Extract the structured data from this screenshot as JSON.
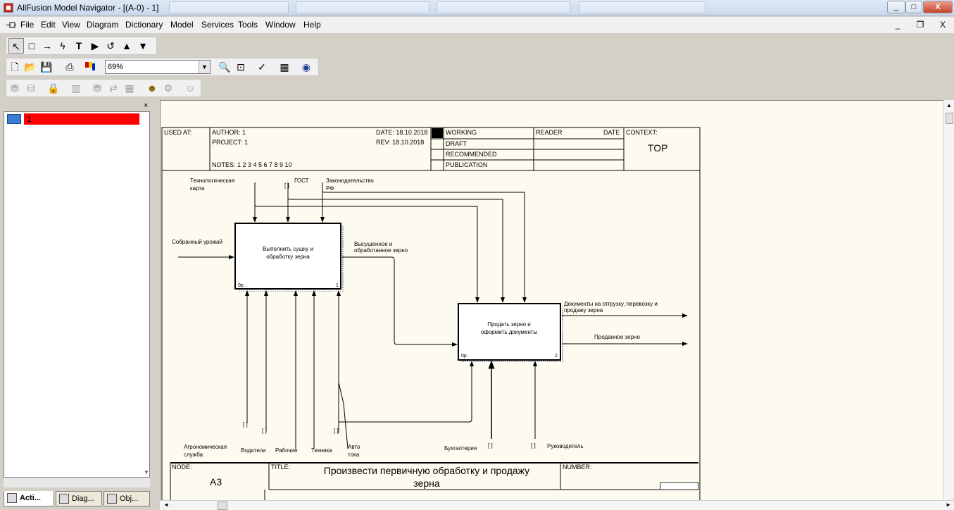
{
  "window": {
    "title": "AllFusion Model Navigator - [(A-0)  - 1]",
    "minimize": "_",
    "maximize": "□",
    "close": "X"
  },
  "menu": {
    "items": [
      "File",
      "Edit",
      "View",
      "Diagram",
      "Dictionary",
      "Model",
      "Services",
      "Tools",
      "Window",
      "Help"
    ],
    "mdi_min": "_",
    "mdi_restore": "❐",
    "mdi_close": "X"
  },
  "toolbar": {
    "zoom_value": "69%"
  },
  "tree": {
    "root_label": "1"
  },
  "tabs": {
    "activities": "Acti...",
    "diagrams": "Diag...",
    "objects": "Obj..."
  },
  "diagram": {
    "header": {
      "used_at": "USED AT:",
      "author": "AUTHOR:  1",
      "project": "PROJECT:  1",
      "date": "DATE:  18.10.2018",
      "rev": "REV:   18.10.2018",
      "notes": "NOTES:  1  2  3  4  5  6  7  8  9  10",
      "working": "WORKING",
      "draft": "DRAFT",
      "recommended": "RECOMMENDED",
      "publication": "PUBLICATION",
      "reader": "READER",
      "date2": "DATE",
      "context": "CONTEXT:",
      "context_value": "TOP"
    },
    "activities": [
      {
        "line1": "Выполнить сушку и",
        "line2": "обработку зерна",
        "cost": "0р.",
        "num": "1"
      },
      {
        "line1": "Продать зерно и",
        "line2": "оформить документы",
        "cost": "0р.",
        "num": "2"
      }
    ],
    "arrows": {
      "tech_card_1": "Технологическая",
      "tech_card_2": "карта",
      "gost": "ГОСТ",
      "law_1": "Законодательство",
      "law_2": "РФ",
      "harvest": "Собранный урожай",
      "dried_1": "Высушенное и",
      "dried_2": "обработанное зерно",
      "docs_1": "Документы на отгрузку, перевозку и",
      "docs_2": "продажу зерна",
      "sold": "Проданное зерно",
      "agro_1": "Агрономическая",
      "agro_2": "служба",
      "drivers": "Водители",
      "workers": "Рабочие",
      "equipment": "Техника",
      "transport_1": "Авто",
      "transport_2": "тока",
      "accounting": "Бухгалтерия",
      "manager": "Руководитель",
      "tunnel": "[ ]"
    },
    "footer": {
      "node": "NODE:",
      "node_value": "A3",
      "title": "TITLE:",
      "title_line1": "Произвести первичную  обработку и продажу",
      "title_line2": "зерна",
      "number": "NUMBER:"
    }
  }
}
